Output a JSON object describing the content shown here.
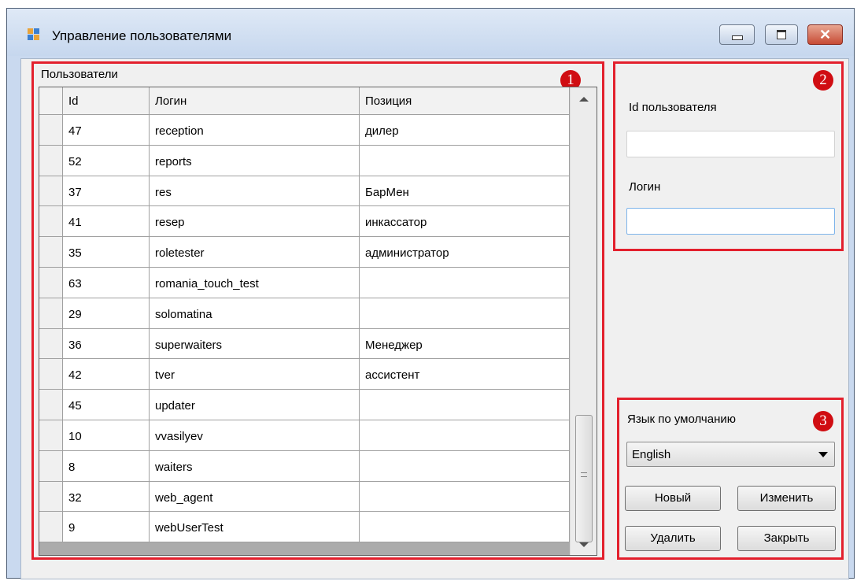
{
  "window": {
    "title": "Управление пользователями",
    "buttons": {
      "minimize_icon": "minimize-icon",
      "maximize_icon": "maximize-icon",
      "close_label": "✕"
    }
  },
  "panel1": {
    "badge": "1",
    "group_label": "Пользователи",
    "columns": [
      "Id",
      "Логин",
      "Позиция"
    ],
    "rows": [
      [
        "47",
        "reception",
        "дилер"
      ],
      [
        "52",
        "reports",
        ""
      ],
      [
        "37",
        "res",
        "БарМен"
      ],
      [
        "41",
        "resep",
        "инкассатор"
      ],
      [
        "35",
        "roletester",
        "администратор"
      ],
      [
        "63",
        "romania_touch_test",
        ""
      ],
      [
        "29",
        "solomatina",
        ""
      ],
      [
        "36",
        "superwaiters",
        "Менеджер"
      ],
      [
        "42",
        "tver",
        "ассистент"
      ],
      [
        "45",
        "updater",
        ""
      ],
      [
        "10",
        "vvasilyev",
        ""
      ],
      [
        "8",
        "waiters",
        ""
      ],
      [
        "32",
        "web_agent",
        ""
      ],
      [
        "9",
        "webUserTest",
        ""
      ]
    ],
    "scroll_position": 0.82
  },
  "panel2": {
    "badge": "2",
    "id_label": "Id пользователя",
    "id_value": "",
    "login_label": "Логин",
    "login_value": ""
  },
  "panel3": {
    "badge": "3",
    "lang_label": "Язык по умолчанию",
    "lang_value": "English",
    "new_button": "Новый",
    "edit_button": "Изменить",
    "delete_button": "Удалить",
    "close_button": "Закрыть"
  },
  "colors": {
    "highlight": "#e3202d",
    "badge": "#d00d12",
    "focus": "#7eb4ea"
  }
}
